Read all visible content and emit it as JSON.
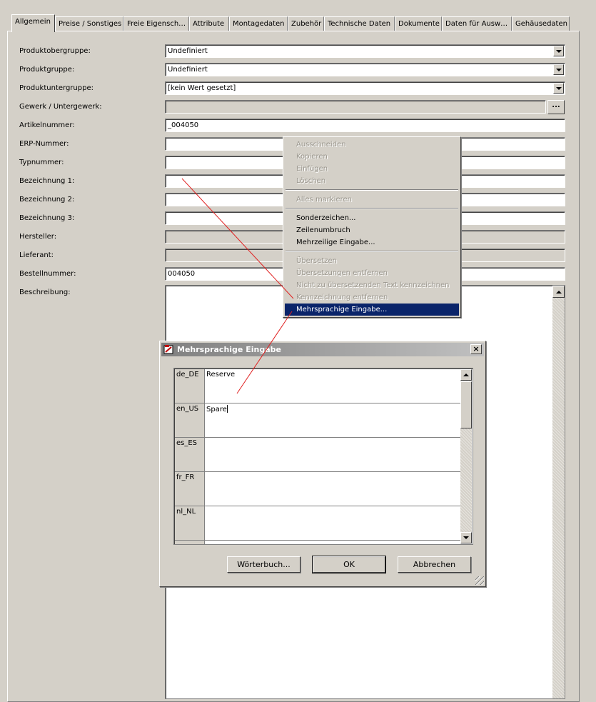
{
  "tabs": [
    "Allgemein",
    "Preise / Sonstiges",
    "Freie Eigensch…",
    "Attribute",
    "Montagedaten",
    "Zubehör",
    "Technische Daten",
    "Dokumente",
    "Daten für Ausw…",
    "Gehäusedaten"
  ],
  "form": {
    "produktobergruppe": {
      "label": "Produktobergruppe:",
      "value": "Undefiniert"
    },
    "produktgruppe": {
      "label": "Produktgruppe:",
      "value": "Undefiniert"
    },
    "produktuntergruppe": {
      "label": "Produktuntergruppe:",
      "value": "[kein Wert gesetzt]"
    },
    "gewerk": {
      "label": "Gewerk / Untergewerk:",
      "value": "",
      "button": "..."
    },
    "artikelnummer": {
      "label": "Artikelnummer:",
      "value": "_004050"
    },
    "erp": {
      "label": "ERP-Nummer:",
      "value": ""
    },
    "typnummer": {
      "label": "Typnummer:",
      "value": ""
    },
    "bez1": {
      "label": "Bezeichnung 1:",
      "value": ""
    },
    "bez2": {
      "label": "Bezeichnung 2:",
      "value": ""
    },
    "bez3": {
      "label": "Bezeichnung 3:",
      "value": ""
    },
    "hersteller": {
      "label": "Hersteller:",
      "value": ""
    },
    "lieferant": {
      "label": "Lieferant:",
      "value": ""
    },
    "bestellnummer": {
      "label": "Bestellnummer:",
      "value": "004050"
    },
    "beschreibung": {
      "label": "Beschreibung:",
      "value": ""
    }
  },
  "context_menu": {
    "ausschneiden": "Ausschneiden",
    "kopieren": "Kopieren",
    "einfuegen": "Einfügen",
    "loeschen": "Löschen",
    "alles_markieren": "Alles markieren",
    "sonderzeichen": "Sonderzeichen...",
    "zeilenumbruch": "Zeilenumbruch",
    "mehrzeilige": "Mehrzeilige Eingabe...",
    "uebersetzen": "Übersetzen",
    "uebersetzungen_entfernen": "Übersetzungen entfernen",
    "nicht_uebersetzen": "Nicht zu übersetzenden Text kennzeichnen",
    "kennzeichnung_entfernen": "Kennzeichnung entfernen",
    "mehrsprachige": "Mehrsprachige Eingabe..."
  },
  "dialog": {
    "title": "Mehrsprachige Eingabe",
    "close": "×",
    "rows": [
      {
        "code": "de_DE",
        "value": "Reserve"
      },
      {
        "code": "en_US",
        "value": "Spare"
      },
      {
        "code": "es_ES",
        "value": ""
      },
      {
        "code": "fr_FR",
        "value": ""
      },
      {
        "code": "nl_NL",
        "value": ""
      }
    ],
    "woerterbuch": "Wörterbuch...",
    "ok": "OK",
    "abbrechen": "Abbrechen"
  },
  "colors": {
    "highlight": "#0a246a",
    "annotation": "#e02020"
  }
}
